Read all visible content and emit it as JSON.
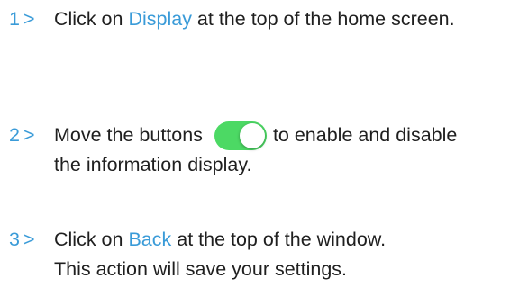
{
  "steps": [
    {
      "number": "1",
      "chevron": ">",
      "text_before": "Click on ",
      "link": "Display",
      "text_after": " at the top of the home screen."
    },
    {
      "number": "2",
      "chevron": ">",
      "text_before": "Move the buttons",
      "toggle_state": "on",
      "text_after": "to enable and disable",
      "line2": "the information display."
    },
    {
      "number": "3",
      "chevron": ">",
      "text_before": "Click on ",
      "link": "Back",
      "text_after": " at the top of the window.",
      "line2": "This action will save your settings."
    }
  ],
  "colors": {
    "accent": "#3a9bd8",
    "toggle_on": "#4cd964",
    "text": "#1f1f1f"
  }
}
